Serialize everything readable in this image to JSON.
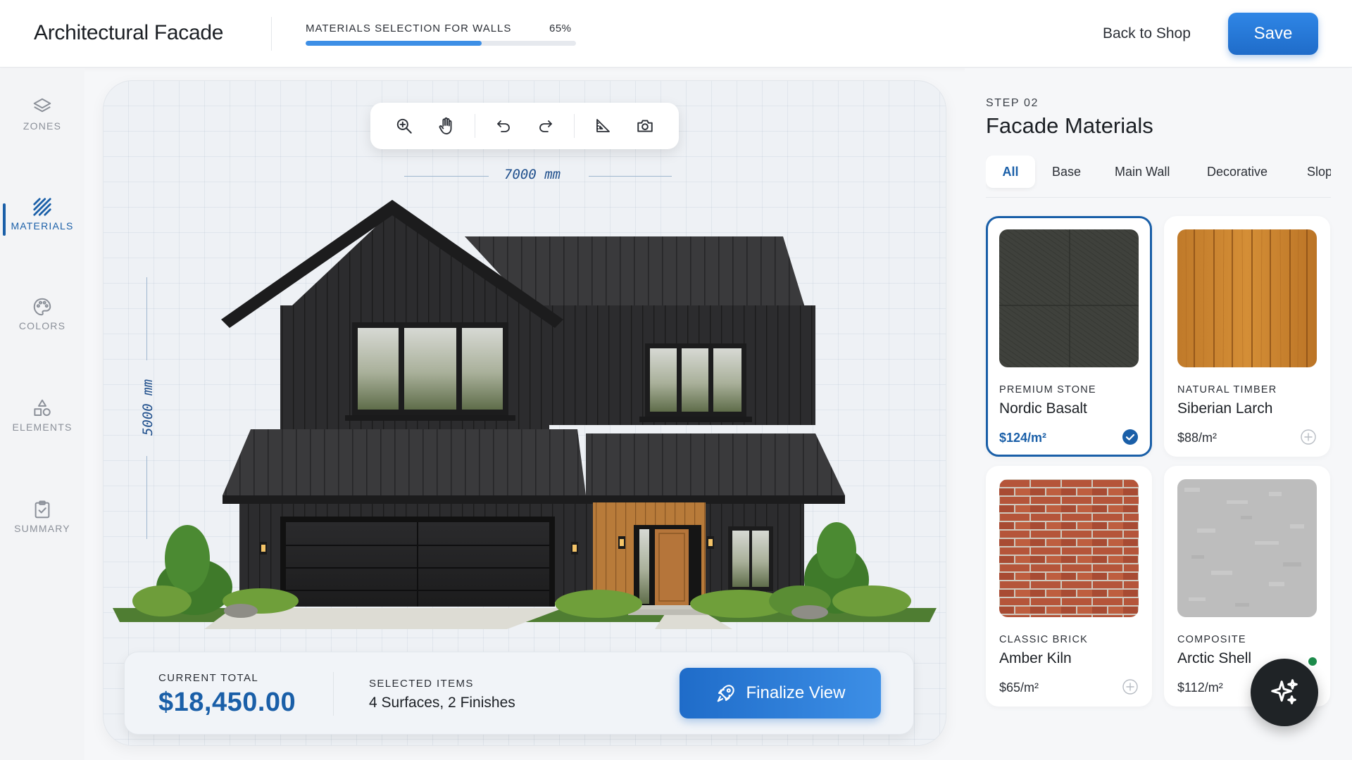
{
  "header": {
    "title": "Architectural Facade",
    "progress": {
      "label": "MATERIALS SELECTION FOR WALLS",
      "value_text": "65%",
      "percent": 65
    },
    "back_link": "Back to Shop",
    "save_label": "Save"
  },
  "sidebar": {
    "items": [
      {
        "label": "ZONES",
        "icon": "layers-icon",
        "active": false
      },
      {
        "label": "MATERIALS",
        "icon": "hatch-icon",
        "active": true
      },
      {
        "label": "COLORS",
        "icon": "palette-icon",
        "active": false
      },
      {
        "label": "ELEMENTS",
        "icon": "shapes-icon",
        "active": false
      },
      {
        "label": "SUMMARY",
        "icon": "clipboard-check-icon",
        "active": false
      }
    ]
  },
  "toolbar": {
    "tools": [
      "zoom-in-icon",
      "pan-hand-icon",
      "undo-icon",
      "redo-icon",
      "measure-icon",
      "camera-icon"
    ]
  },
  "canvas": {
    "width_dimension": "7000 mm",
    "height_dimension": "5000 mm"
  },
  "summary": {
    "total_label": "CURRENT TOTAL",
    "total_value": "$18,450.00",
    "items_label": "SELECTED ITEMS",
    "items_value": "4 Surfaces, 2 Finishes",
    "finalize_label": "Finalize View"
  },
  "panel": {
    "step": "STEP 02",
    "title": "Facade Materials",
    "tabs": [
      {
        "label": "All",
        "active": true
      },
      {
        "label": "Base",
        "active": false
      },
      {
        "label": "Main Wall",
        "active": false
      },
      {
        "label": "Decorative",
        "active": false
      },
      {
        "label": "Slop",
        "active": false
      }
    ],
    "materials": [
      {
        "category": "PREMIUM STONE",
        "name": "Nordic Basalt",
        "price": "$124/m²",
        "selected": true
      },
      {
        "category": "NATURAL TIMBER",
        "name": "Siberian Larch",
        "price": "$88/m²",
        "selected": false
      },
      {
        "category": "CLASSIC BRICK",
        "name": "Amber Kiln",
        "price": "$65/m²",
        "selected": false
      },
      {
        "category": "COMPOSITE",
        "name": "Arctic Shell",
        "price": "$112/m²",
        "selected": false
      }
    ]
  },
  "colors": {
    "accent": "#1a5fa8",
    "accent_light": "#3d8fe6",
    "status_online": "#1c8a4a"
  }
}
